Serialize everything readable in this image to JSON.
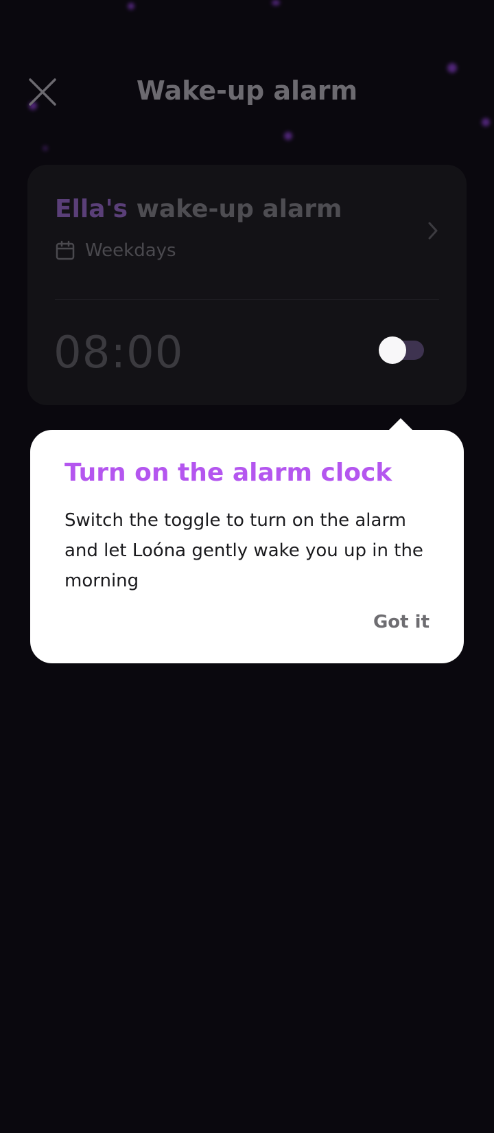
{
  "header": {
    "title": "Wake-up alarm",
    "close_icon": "close-icon"
  },
  "alarm_card": {
    "owner": "Ella's",
    "title_rest": "wake-up alarm",
    "schedule": "Weekdays",
    "schedule_icon": "calendar-icon",
    "chevron_icon": "chevron-right-icon",
    "time": "08:00",
    "toggle_on": false
  },
  "tooltip": {
    "title": "Turn on the alarm clock",
    "body": "Switch the toggle to turn on the alarm and let Loóna gently wake you up in the morning",
    "dismiss_label": "Got it"
  },
  "colors": {
    "background": "#0a080e",
    "card": "#131216",
    "accent": "#b456ef",
    "owner_name": "#5a3f78",
    "toggle_track": "#3e3350"
  }
}
